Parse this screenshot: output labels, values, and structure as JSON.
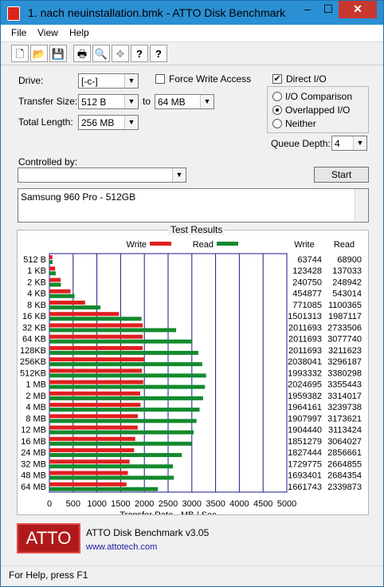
{
  "window": {
    "title": "1. nach neuinstallation.bmk - ATTO Disk Benchmark"
  },
  "titlebar": {
    "minimize": "–",
    "maximize": "☐",
    "close": "✕"
  },
  "menu": {
    "file": "File",
    "view": "View",
    "help": "Help"
  },
  "toolbar": {
    "icons": [
      "new-document-icon",
      "open-folder-icon",
      "save-icon",
      "print-icon",
      "print-preview-icon",
      "move-icon",
      "help-icon",
      "context-help-icon"
    ],
    "glyphs": [
      "🗋",
      "📂",
      "💾",
      "🖶",
      "🔍",
      "✥",
      "?",
      "?"
    ]
  },
  "form": {
    "drive_label": "Drive:",
    "drive_value": "[-c-]",
    "force_write_label": "Force Write Access",
    "force_write_checked": false,
    "direct_io_label": "Direct I/O",
    "direct_io_checked": true,
    "transfer_size_label": "Transfer Size:",
    "transfer_from": "512 B",
    "to_label": "to",
    "transfer_to": "64 MB",
    "total_length_label": "Total Length:",
    "total_length": "256 MB",
    "io_comparison_label": "I/O Comparison",
    "overlapped_io_label": "Overlapped I/O",
    "neither_label": "Neither",
    "selected_mode": "Overlapped I/O",
    "queue_depth_label": "Queue Depth:",
    "queue_depth": "4",
    "controlled_by_label": "Controlled by:",
    "controlled_by_value": "",
    "start_label": "Start",
    "description": "Samsung 960 Pro - 512GB"
  },
  "results": {
    "legend_label": "Test Results",
    "write_label": "Write",
    "read_label": "Read",
    "col_write": "Write",
    "col_read": "Read"
  },
  "chart_data": {
    "type": "bar",
    "orientation": "horizontal",
    "categories": [
      "512 B",
      "1 KB",
      "2 KB",
      "4 KB",
      "8 KB",
      "16 KB",
      "32 KB",
      "64 KB",
      "128KB",
      "256KB",
      "512KB",
      "1 MB",
      "2 MB",
      "4 MB",
      "8 MB",
      "12 MB",
      "16 MB",
      "24 MB",
      "32 MB",
      "48 MB",
      "64 MB"
    ],
    "series": [
      {
        "name": "Write",
        "color": "#e02020",
        "values": [
          63744,
          123428,
          240750,
          454877,
          771085,
          1501313,
          2011693,
          2011693,
          2011693,
          2038041,
          1993332,
          2024695,
          1959382,
          1964161,
          1907997,
          1904440,
          1851279,
          1827444,
          1729775,
          1693401,
          1661743
        ]
      },
      {
        "name": "Read",
        "color": "#138a2e",
        "values": [
          68900,
          137033,
          248942,
          543014,
          1100365,
          1987117,
          2733506,
          3077740,
          3211623,
          3296187,
          3380298,
          3355443,
          3314017,
          3239738,
          3173621,
          3113424,
          3064027,
          2856661,
          2664855,
          2684354,
          2339873
        ]
      }
    ],
    "values_unit": "KB/s",
    "xlabel": "Transfer Rate - MB / Sec",
    "xticks": [
      0,
      500,
      1000,
      1500,
      2000,
      2500,
      3000,
      3500,
      4000,
      4500,
      5000
    ],
    "xlim": [
      0,
      5000
    ],
    "write_column": [
      "63744",
      "123428",
      "240750",
      "454877",
      "771085",
      "1501313",
      "2011693",
      "2011693",
      "2011693",
      "2038041",
      "1993332",
      "2024695",
      "1959382",
      "1964161",
      "1907997",
      "1904440",
      "1851279",
      "1827444",
      "1729775",
      "1693401",
      "1661743"
    ],
    "read_column": [
      "68900",
      "137033",
      "248942",
      "543014",
      "1100365",
      "1987117",
      "2733506",
      "3077740",
      "3211623",
      "3296187",
      "3380298",
      "3355443",
      "3314017",
      "3239738",
      "3173621",
      "3113424",
      "3064027",
      "2856661",
      "2664855",
      "2684354",
      "2339873"
    ]
  },
  "footer": {
    "logo_text": "ATTO",
    "product": "ATTO Disk Benchmark v3.05",
    "url": "www.attotech.com"
  },
  "status": {
    "text": "For Help, press F1"
  },
  "colors": {
    "titlebar": "#2b8fd3",
    "close": "#c7372f",
    "grid_line": "#1a1a8c",
    "write": "#e02020",
    "read": "#138a2e",
    "link": "#1a1aa6",
    "logo": "#b11a1a"
  }
}
